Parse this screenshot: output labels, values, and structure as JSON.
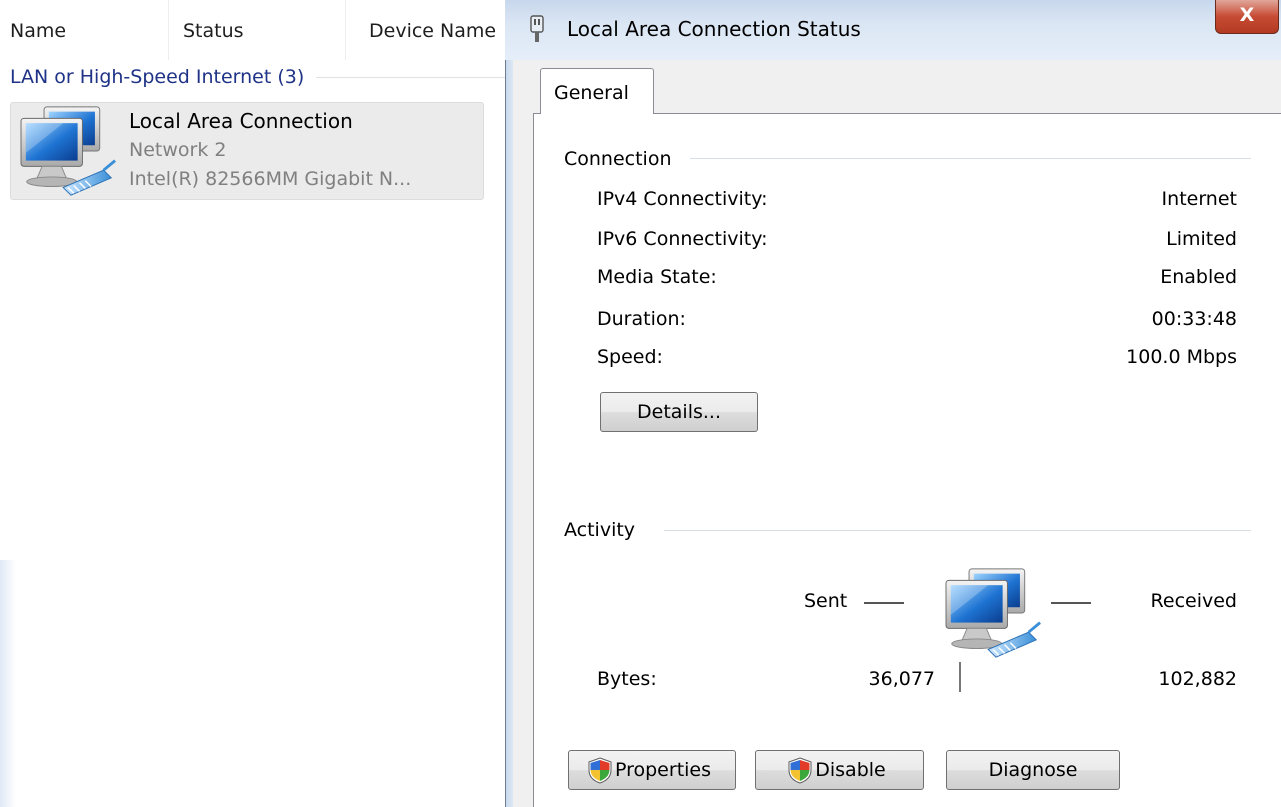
{
  "explorer": {
    "columns": [
      "Name",
      "Status",
      "Device Name"
    ],
    "group_header": "LAN or High-Speed Internet (3)",
    "item": {
      "name": "Local Area Connection",
      "network": "Network  2",
      "device": "Intel(R) 82566MM Gigabit N...",
      "icon": "network-computers-icon"
    }
  },
  "dialog": {
    "title": "Local Area Connection Status",
    "close_label": "X",
    "tab": "General",
    "connection": {
      "title": "Connection",
      "rows": [
        {
          "label": "IPv4 Connectivity:",
          "value": "Internet"
        },
        {
          "label": "IPv6 Connectivity:",
          "value": "Limited"
        },
        {
          "label": "Media State:",
          "value": "Enabled"
        },
        {
          "label": "Duration:",
          "value": "00:33:48"
        },
        {
          "label": "Speed:",
          "value": "100.0 Mbps"
        }
      ],
      "details_button": "Details..."
    },
    "activity": {
      "title": "Activity",
      "sent_label": "Sent",
      "received_label": "Received",
      "bytes_label": "Bytes:",
      "bytes_sent": "36,077",
      "bytes_received": "102,882"
    },
    "buttons": {
      "properties": "Properties",
      "disable": "Disable",
      "diagnose": "Diagnose"
    }
  },
  "colors": {
    "group_header": "#1e3287",
    "titlebar": "#dbe6f4",
    "close_button": "#c74b34",
    "dialog_face": "#f0f0f0"
  }
}
